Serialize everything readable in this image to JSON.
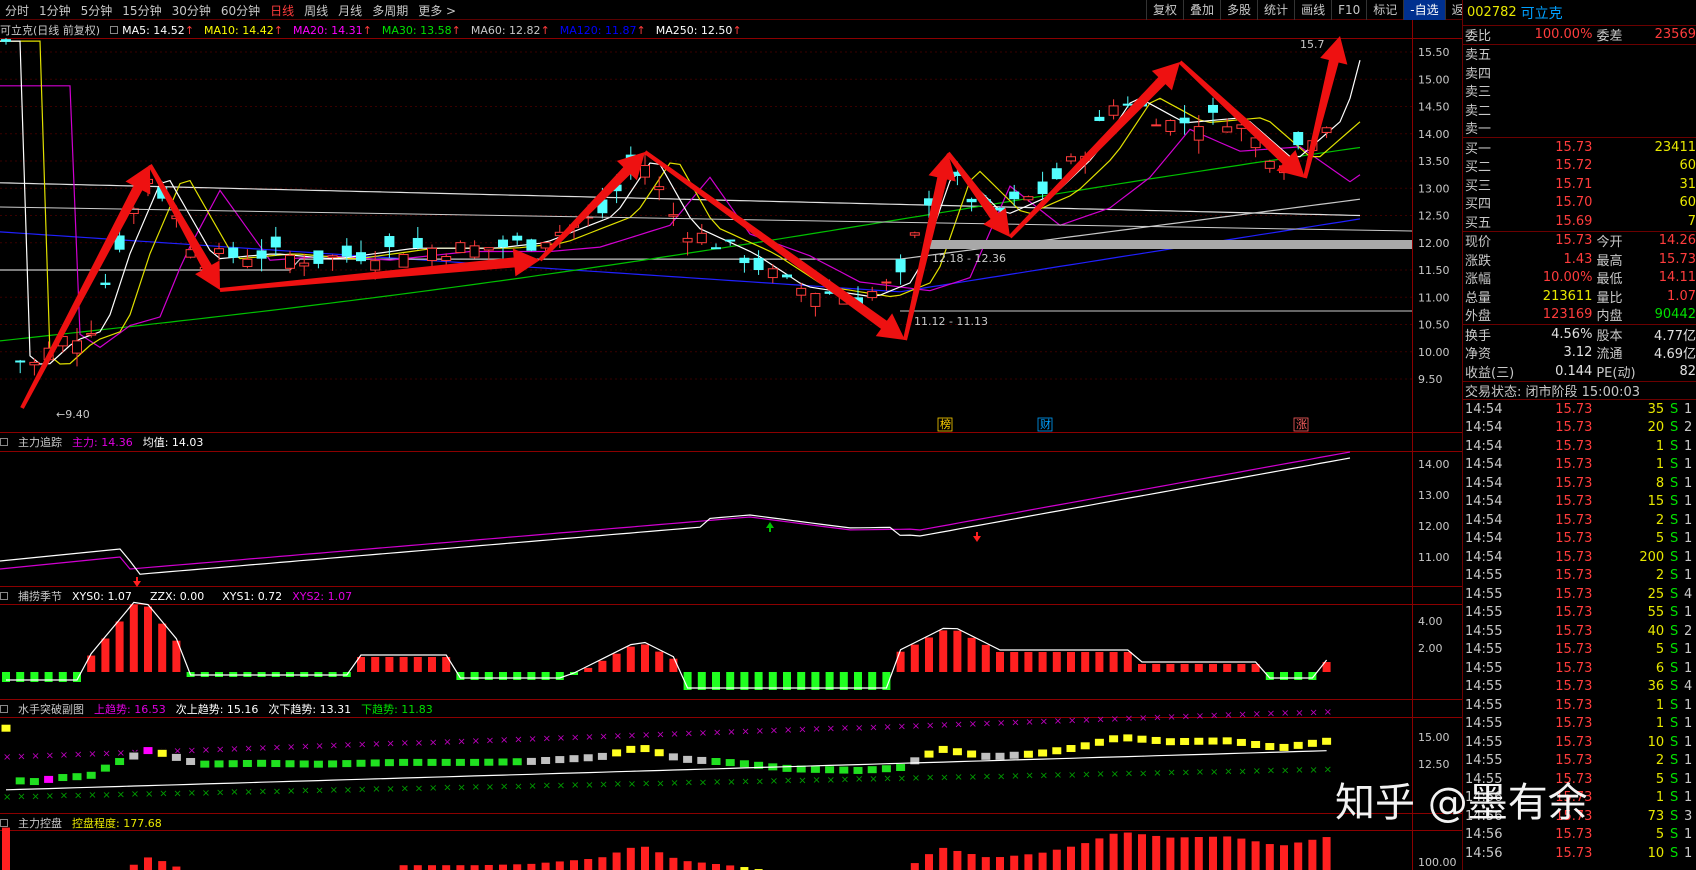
{
  "toolbar": {
    "periods": [
      "分时",
      "1分钟",
      "5分钟",
      "15分钟",
      "30分钟",
      "60分钟",
      "日线",
      "周线",
      "月线",
      "多周期",
      "更多 >"
    ],
    "active_period": "日线",
    "tools": [
      "复权",
      "叠加",
      "多股",
      "统计",
      "画线",
      "F10",
      "标记",
      "-自选",
      "返回"
    ],
    "active_tool": "-自选"
  },
  "main_panel": {
    "title": "可立克(日线 前复权)",
    "ma": [
      {
        "label": "MA5: 14.52",
        "color": "#ffffff"
      },
      {
        "label": "MA10: 14.42",
        "color": "#ffff00"
      },
      {
        "label": "MA20: 14.31",
        "color": "#ff00ff"
      },
      {
        "label": "MA30: 13.58",
        "color": "#00e000"
      },
      {
        "label": "MA60: 12.82",
        "color": "#c8c8c8"
      },
      {
        "label": "MA120: 11.87",
        "color": "#0000ff"
      },
      {
        "label": "MA250: 12.50",
        "color": "#ffffff"
      }
    ],
    "axis": [
      "15.50",
      "15.00",
      "14.50",
      "14.00",
      "13.50",
      "13.00",
      "12.50",
      "12.00",
      "11.50",
      "11.00",
      "10.50",
      "10.00",
      "9.50"
    ],
    "annotations": {
      "high": "15.7",
      "low": "←9.40",
      "gap1": "12.18 - 12.36",
      "gap2": "11.12 - 11.13"
    },
    "events": [
      "榜",
      "财",
      "涨"
    ],
    "events_colors": [
      "#ffd000",
      "#00a0ff",
      "#ff6060"
    ]
  },
  "panel2": {
    "name": "主力追踪",
    "main_label": "主力: 14.36",
    "avg_label": "均值: 14.03",
    "axis": [
      "14.00",
      "13.00",
      "12.00",
      "11.00"
    ]
  },
  "panel3": {
    "name": "捕捞季节",
    "labels": [
      "XYS0: 1.07",
      "ZZX: 0.00",
      "XYS1: 0.72",
      "XYS2: 1.07"
    ],
    "axis": [
      "4.00",
      "2.00"
    ]
  },
  "panel4": {
    "name": "水手突破副图",
    "labels": [
      "上趋势: 16.53",
      "次上趋势: 15.16",
      "次下趋势: 13.31",
      "下趋势: 11.83"
    ],
    "axis": [
      "15.00",
      "12.50"
    ]
  },
  "panel5": {
    "name": "主力控盘",
    "label": "控盘程度: 177.68",
    "axis": [
      "100.00"
    ]
  },
  "sidebar": {
    "code": "002782",
    "name": "可立克",
    "wb": {
      "label": "委比",
      "value": "100.00%",
      "label2": "委差",
      "value2": "23569"
    },
    "asks": [
      "卖五",
      "卖四",
      "卖三",
      "卖二",
      "卖一"
    ],
    "bids": [
      {
        "label": "买一",
        "price": "15.73",
        "vol": "23411"
      },
      {
        "label": "买二",
        "price": "15.72",
        "vol": "60"
      },
      {
        "label": "买三",
        "price": "15.71",
        "vol": "31"
      },
      {
        "label": "买四",
        "price": "15.70",
        "vol": "60"
      },
      {
        "label": "买五",
        "price": "15.69",
        "vol": "7"
      }
    ],
    "quote": [
      {
        "l1": "现价",
        "v1": "15.73",
        "c1": "#ff3c3c",
        "l2": "今开",
        "v2": "14.26",
        "c2": "#ff3c3c"
      },
      {
        "l1": "涨跌",
        "v1": "1.43",
        "c1": "#ff3c3c",
        "l2": "最高",
        "v2": "15.73",
        "c2": "#ff3c3c"
      },
      {
        "l1": "涨幅",
        "v1": "10.00%",
        "c1": "#ff3c3c",
        "l2": "最低",
        "v2": "14.11",
        "c2": "#ff3c3c"
      },
      {
        "l1": "总量",
        "v1": "213611",
        "c1": "#e8e800",
        "l2": "量比",
        "v2": "1.07",
        "c2": "#ff3c3c"
      },
      {
        "l1": "外盘",
        "v1": "123169",
        "c1": "#ff3c3c",
        "l2": "内盘",
        "v2": "90442",
        "c2": "#00e000"
      }
    ],
    "fund": [
      {
        "l1": "换手",
        "v1": "4.56%",
        "l2": "股本",
        "v2": "4.77亿"
      },
      {
        "l1": "净资",
        "v1": "3.12",
        "l2": "流通",
        "v2": "4.69亿"
      },
      {
        "l1": "收益(三)",
        "v1": "0.144",
        "l2": "PE(动)",
        "v2": "82"
      }
    ],
    "status": "交易状态: 闭市阶段 15:00:03",
    "ticks": [
      {
        "t": "14:54",
        "p": "15.73",
        "v": "35",
        "f": "S",
        "n": "1"
      },
      {
        "t": "14:54",
        "p": "15.73",
        "v": "20",
        "f": "S",
        "n": "2"
      },
      {
        "t": "14:54",
        "p": "15.73",
        "v": "1",
        "f": "S",
        "n": "1"
      },
      {
        "t": "14:54",
        "p": "15.73",
        "v": "1",
        "f": "S",
        "n": "1"
      },
      {
        "t": "14:54",
        "p": "15.73",
        "v": "8",
        "f": "S",
        "n": "1"
      },
      {
        "t": "14:54",
        "p": "15.73",
        "v": "15",
        "f": "S",
        "n": "1"
      },
      {
        "t": "14:54",
        "p": "15.73",
        "v": "2",
        "f": "S",
        "n": "1"
      },
      {
        "t": "14:54",
        "p": "15.73",
        "v": "5",
        "f": "S",
        "n": "1"
      },
      {
        "t": "14:54",
        "p": "15.73",
        "v": "200",
        "f": "S",
        "n": "1"
      },
      {
        "t": "14:55",
        "p": "15.73",
        "v": "2",
        "f": "S",
        "n": "1"
      },
      {
        "t": "14:55",
        "p": "15.73",
        "v": "25",
        "f": "S",
        "n": "4"
      },
      {
        "t": "14:55",
        "p": "15.73",
        "v": "55",
        "f": "S",
        "n": "1"
      },
      {
        "t": "14:55",
        "p": "15.73",
        "v": "40",
        "f": "S",
        "n": "2"
      },
      {
        "t": "14:55",
        "p": "15.73",
        "v": "5",
        "f": "S",
        "n": "1"
      },
      {
        "t": "14:55",
        "p": "15.73",
        "v": "6",
        "f": "S",
        "n": "1"
      },
      {
        "t": "14:55",
        "p": "15.73",
        "v": "36",
        "f": "S",
        "n": "4"
      },
      {
        "t": "14:55",
        "p": "15.73",
        "v": "1",
        "f": "S",
        "n": "1"
      },
      {
        "t": "14:55",
        "p": "15.73",
        "v": "1",
        "f": "S",
        "n": "1"
      },
      {
        "t": "14:55",
        "p": "15.73",
        "v": "10",
        "f": "S",
        "n": "1"
      },
      {
        "t": "14:55",
        "p": "15.73",
        "v": "2",
        "f": "S",
        "n": "1"
      },
      {
        "t": "14:55",
        "p": "15.73",
        "v": "5",
        "f": "S",
        "n": "1"
      },
      {
        "t": "14:56",
        "p": "15.73",
        "v": "1",
        "f": "S",
        "n": "1"
      },
      {
        "t": "14:56",
        "p": "15.73",
        "v": "73",
        "f": "S",
        "n": "3"
      },
      {
        "t": "14:56",
        "p": "15.73",
        "v": "5",
        "f": "S",
        "n": "1"
      },
      {
        "t": "14:56",
        "p": "15.73",
        "v": "10",
        "f": "S",
        "n": "1"
      }
    ]
  },
  "watermark": "知乎 @墨有余"
}
